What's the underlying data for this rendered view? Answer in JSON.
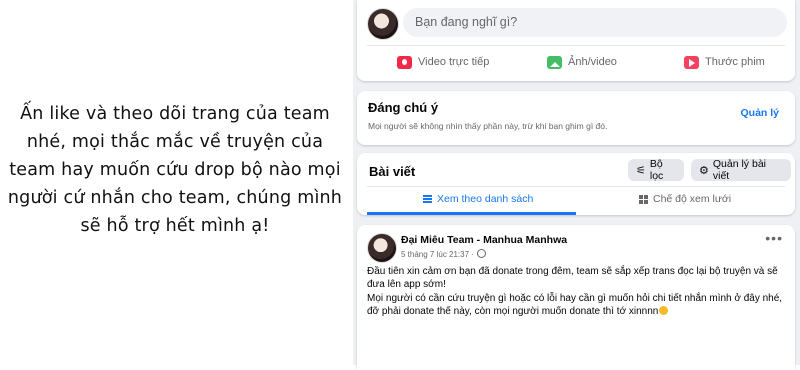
{
  "caption": {
    "lines": [
      "Ấn like và theo dõi trang của team",
      "nhé, mọi thắc mắc về truyện của",
      "team hay muốn cứu drop bộ nào mọi",
      "người cứ nhắn cho team, chúng mình",
      "sẽ hỗ trợ hết mình ạ!"
    ]
  },
  "composer": {
    "placeholder": "Bạn đang nghĩ gì?",
    "actions": [
      {
        "label": "Video trực tiếp",
        "icon": "live-video-icon",
        "color": "#f02849"
      },
      {
        "label": "Ảnh/video",
        "icon": "photo-icon",
        "color": "#45bd62"
      },
      {
        "label": "Thước phim",
        "icon": "reel-icon",
        "color": "#f3425f"
      }
    ]
  },
  "notice": {
    "title": "Đáng chú ý",
    "subtitle": "Mọi người sẽ không nhìn thấy phần này, trừ khi bạn ghim gì đó.",
    "manage_label": "Quản lý"
  },
  "posts": {
    "title": "Bài viết",
    "filter_label": "Bộ lọc",
    "manage_label": "Quản lý bài viết",
    "tabs": [
      {
        "label": "Xem theo danh sách",
        "active": true
      },
      {
        "label": "Chế độ xem lưới",
        "active": false
      }
    ]
  },
  "post": {
    "author": "Đại Miêu Team - Manhua Manhwa",
    "timestamp": "5 tháng 7 lúc 21:37 ·",
    "paragraph1": "Đầu tiên xin cảm ơn bạn đã donate trong đêm, team sẽ sắp xếp trans đọc lại bộ truyện và sẽ đưa lên app sớm!",
    "paragraph2": "Mọi người có cần cứu truyện gì hoặc có lỗi hay cần gì muốn hỏi chi tiết nhắn mình ở đây nhé, đỡ phải donate thế này, còn mọi người muốn donate thì tớ xinnnn"
  },
  "colors": {
    "accent": "#1877f2",
    "page_bg": "#eef0f3"
  }
}
